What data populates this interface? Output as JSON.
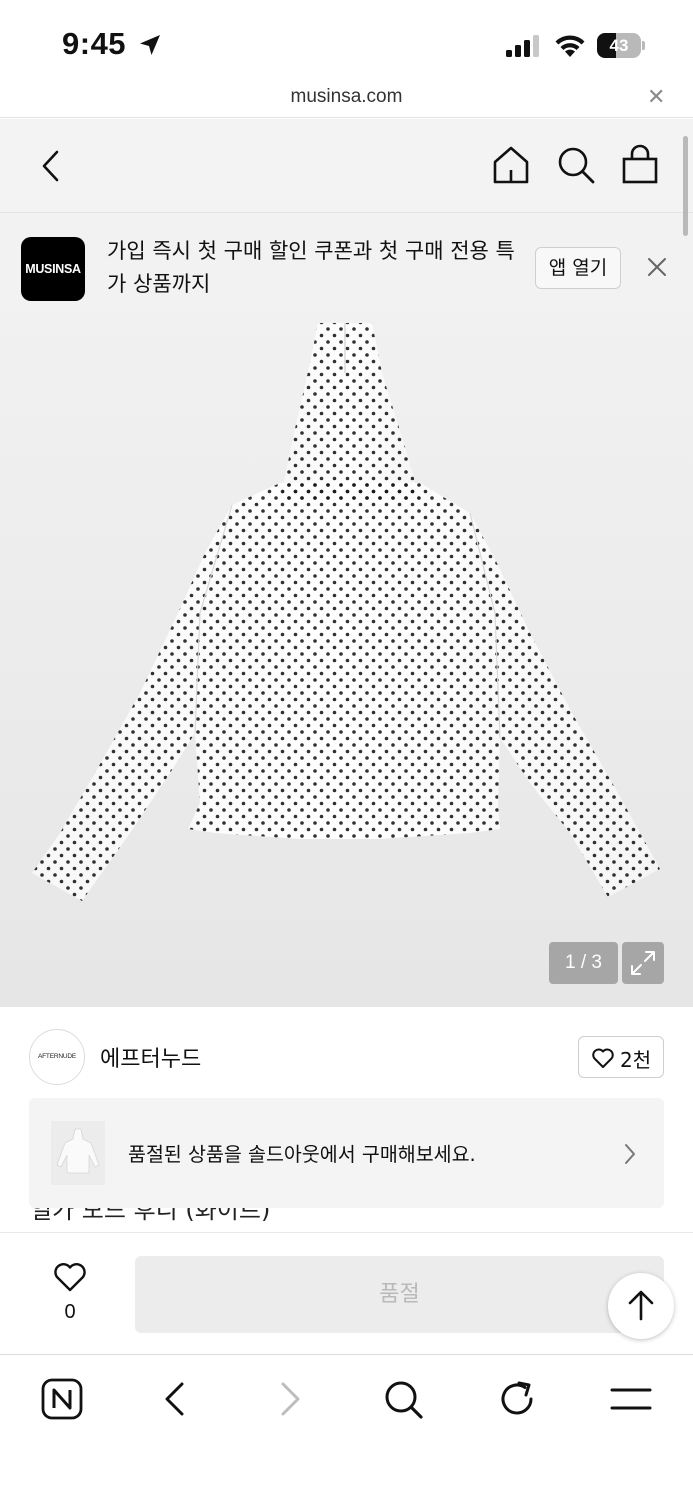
{
  "status_bar": {
    "time": "9:45",
    "battery": "43",
    "battery_level": 0.43
  },
  "browser": {
    "url": "musinsa.com"
  },
  "promo": {
    "logo_text": "MUSINSA",
    "message": "가입 즉시 첫 구매 할인 쿠폰과 첫 구매 전용 특가 상품까지",
    "open_app_label": "앱 열기"
  },
  "product": {
    "image_counter": "1 / 3",
    "partial_title": "일가 모드 후디 (화이트)"
  },
  "brand": {
    "avatar_text": "AFTERNUDE",
    "name": "에프터누드",
    "like_count": "2천"
  },
  "soldout_banner": {
    "text": "품절된 상품을 솔드아웃에서 구매해보세요."
  },
  "buy_bar": {
    "wish_count": "0",
    "soldout_label": "품절"
  },
  "icons": [
    "location-icon",
    "signal-icon",
    "wifi-icon",
    "back-icon",
    "home-icon",
    "search-icon",
    "bag-icon",
    "close-icon",
    "expand-icon",
    "heart-icon",
    "chevron-right-icon",
    "arrow-up-icon",
    "naver-icon",
    "chevron-left-icon",
    "refresh-icon",
    "menu-icon"
  ],
  "colors": {
    "brand_black": "#000000",
    "disabled_button": "#ececec",
    "disabled_text": "#b9b9b9"
  }
}
